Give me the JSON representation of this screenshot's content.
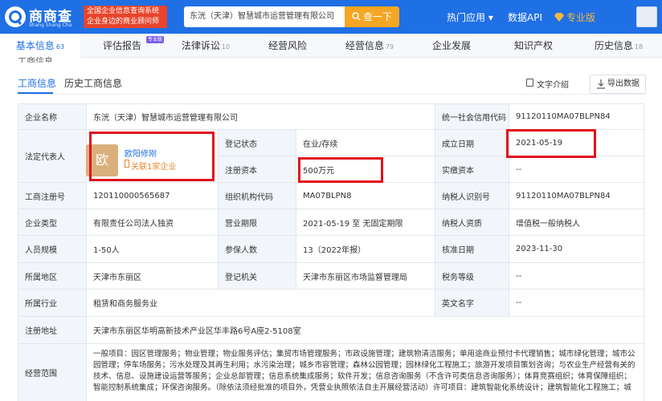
{
  "header": {
    "logo_cn": "商商查",
    "logo_en": "Shang Shang Cha",
    "slogan_line1": "全国企业信息查询系统",
    "slogan_line2": "企业身边的商业顾问师",
    "search_value": "东洸（天津）智慧城市运营管理有限公司",
    "search_button": "查一下",
    "nav_hot": "热门应用 ▾",
    "nav_api": "数据API",
    "nav_pro": "专业版"
  },
  "tabs": [
    {
      "label": "基本信息",
      "count": "63"
    },
    {
      "label": "评估报告",
      "count": "",
      "badge": "专业版"
    },
    {
      "label": "法律诉讼",
      "count": "10"
    },
    {
      "label": "经营风险",
      "count": ""
    },
    {
      "label": "经营信息",
      "count": "79"
    },
    {
      "label": "企业发展",
      "count": ""
    },
    {
      "label": "知识产权",
      "count": ""
    },
    {
      "label": "历史信息",
      "count": "18"
    }
  ],
  "section": {
    "title": "工商信息",
    "subtab_active": "工商信息",
    "subtab_history": "历史工商信息",
    "intro_button": "文字介绍",
    "export_button": "导出数据"
  },
  "company": {
    "name_label": "企业名称",
    "name": "东洸（天津）智慧城市运营管理有限公司",
    "credit_code_label": "统一社会信用代码",
    "credit_code": "91120110MA07BLPN84",
    "legal_rep_label": "法定代表人",
    "legal_rep_avatar": "欧",
    "legal_rep_name": "欧阳修刚",
    "legal_rep_relation": "关联1家企业",
    "status_label": "登记状态",
    "status": "在业/存续",
    "found_date_label": "成立日期",
    "found_date": "2021-05-19",
    "capital_label": "注册资本",
    "capital": "500万元",
    "paid_capital_label": "实缴资本",
    "paid_capital": "--",
    "reg_no_label": "工商注册号",
    "reg_no": "120110000565687",
    "org_code_label": "组织机构代码",
    "org_code": "MA07BLPN8",
    "taxpayer_id_label": "纳税人识别号",
    "taxpayer_id": "91120110MA07BLPN84",
    "type_label": "企业类型",
    "type": "有限责任公司法人独资",
    "term_label": "营业期限",
    "term": "2021-05-19 至 无固定期限",
    "taxpayer_qual_label": "纳税人资质",
    "taxpayer_qual": "增值税一般纳税人",
    "staff_label": "人员规模",
    "staff": "1-50人",
    "insured_label": "参保人数",
    "insured": "13（2022年报）",
    "approve_date_label": "核准日期",
    "approve_date": "2023-11-30",
    "region_label": "所属地区",
    "region": "天津市东丽区",
    "authority_label": "登记机关",
    "authority": "天津市东丽区市场监督管理局",
    "tax_grade_label": "税务等级",
    "tax_grade": "--",
    "industry_label": "所属行业",
    "industry": "租赁和商务服务业",
    "en_name_label": "英文名字",
    "en_name": "--",
    "address_label": "注册地址",
    "address": "天津市东丽区华明高新技术产业区华丰路6号A座2-5108室",
    "scope_label": "经营范围",
    "scope": "一般项目：园区管理服务；物业管理；物业服务评估；集贸市场管理服务；市政设施管理；建筑物清洁服务；单用途商业预付卡代理销售；城市绿化管理；城市公园管理；停车场服务；污水处理及其再生利用；水污染治理；城乡市容管理；森林公园管理；园林绿化工程施工；旅游开发项目策划咨询；与农业生产经营有关的技术、信息、设施建设运营等服务；企业总部管理；信息系统集成服务；软件开发；信息咨询服务（不含许可类信息咨询服务）；体育竞赛组织；体育保障组织；智能控制系统集成；环保咨询服务。（除依法须经批准的项目外，凭营业执照依法自主开展经营活动）许可项目：建筑智能化系统设计；建筑智能化工程施工；城"
  }
}
